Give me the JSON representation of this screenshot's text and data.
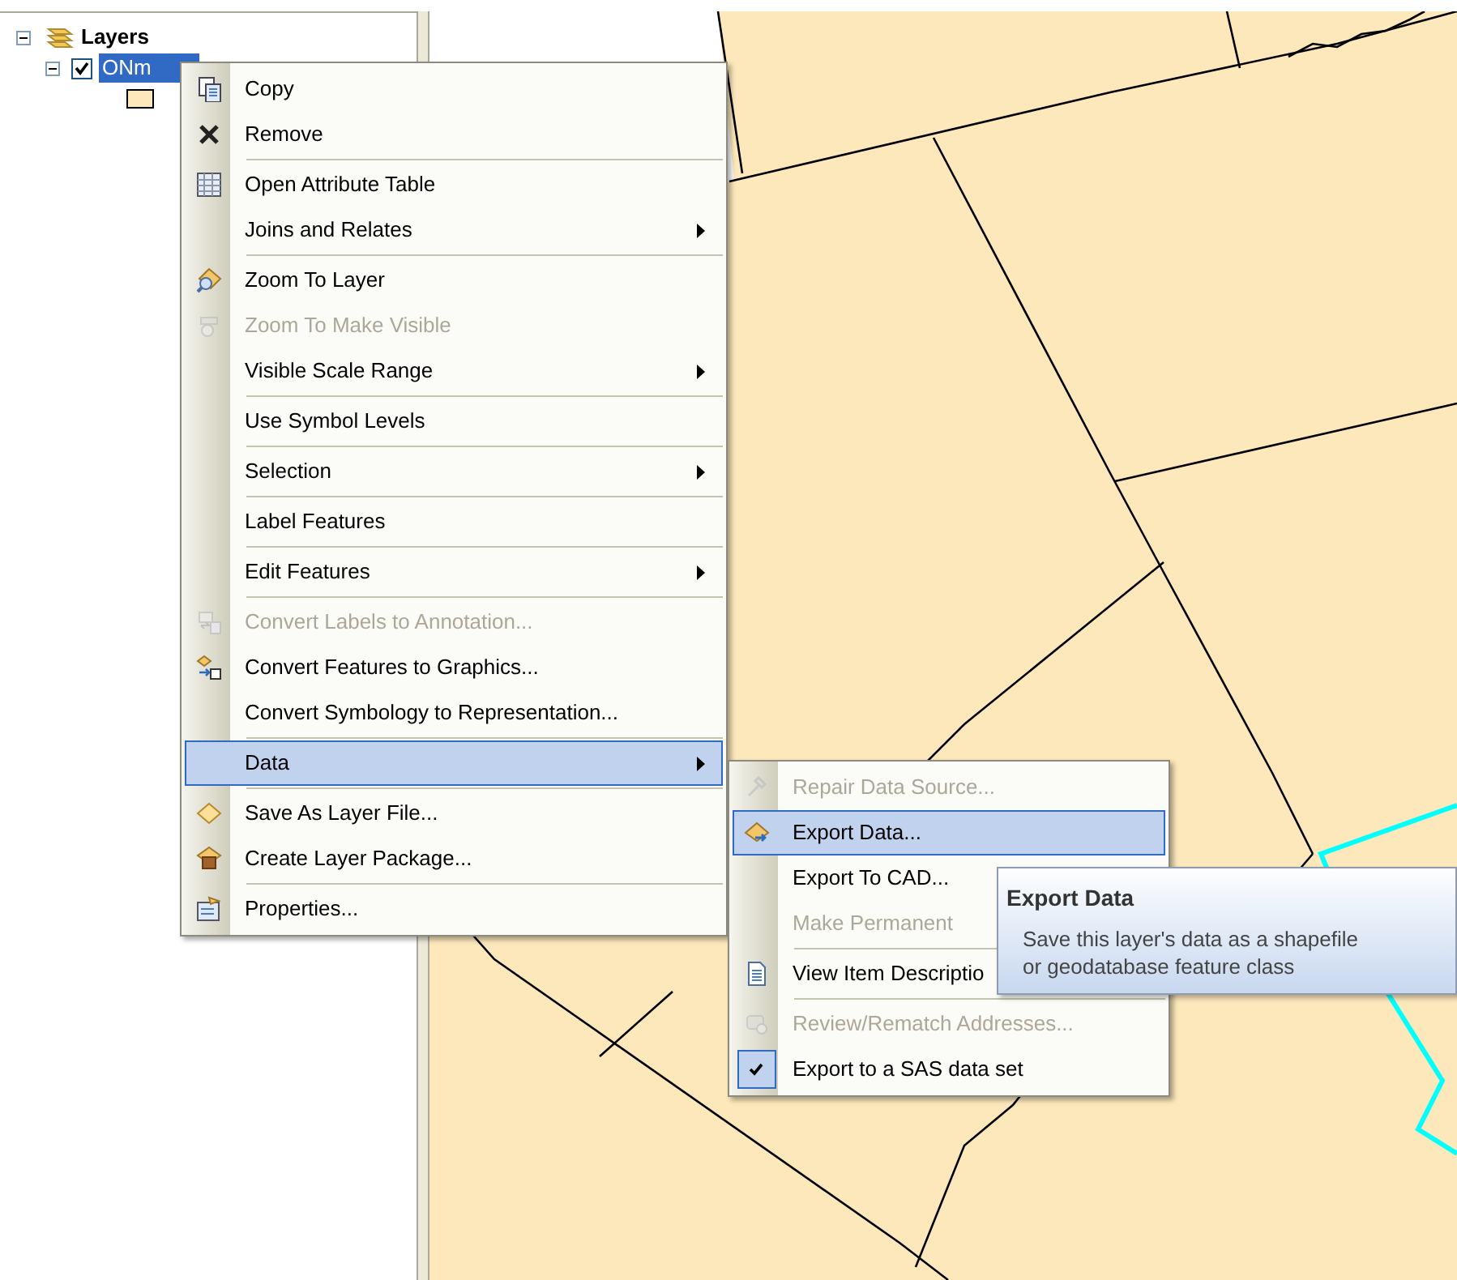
{
  "toc": {
    "label": "Layers",
    "expanded": true,
    "children": [
      {
        "label": "ONm",
        "checked": true,
        "selected": true,
        "expanded": true
      }
    ]
  },
  "context_menu": {
    "items": [
      {
        "kind": "item",
        "label": "Copy",
        "disabled": false,
        "submenu": false,
        "selected": false
      },
      {
        "kind": "item",
        "label": "Remove",
        "disabled": false,
        "submenu": false,
        "selected": false
      },
      {
        "kind": "separator"
      },
      {
        "kind": "item",
        "label": "Open Attribute Table",
        "disabled": false,
        "submenu": false,
        "selected": false
      },
      {
        "kind": "item",
        "label": "Joins and Relates",
        "disabled": false,
        "submenu": true,
        "selected": false
      },
      {
        "kind": "separator"
      },
      {
        "kind": "item",
        "label": "Zoom To Layer",
        "disabled": false,
        "submenu": false,
        "selected": false
      },
      {
        "kind": "item",
        "label": "Zoom To Make Visible",
        "disabled": true,
        "submenu": false,
        "selected": false
      },
      {
        "kind": "item",
        "label": "Visible Scale Range",
        "disabled": false,
        "submenu": true,
        "selected": false
      },
      {
        "kind": "separator"
      },
      {
        "kind": "item",
        "label": "Use Symbol Levels",
        "disabled": false,
        "submenu": false,
        "selected": false
      },
      {
        "kind": "separator"
      },
      {
        "kind": "item",
        "label": "Selection",
        "disabled": false,
        "submenu": true,
        "selected": false
      },
      {
        "kind": "separator"
      },
      {
        "kind": "item",
        "label": "Label Features",
        "disabled": false,
        "submenu": false,
        "selected": false
      },
      {
        "kind": "separator"
      },
      {
        "kind": "item",
        "label": "Edit Features",
        "disabled": false,
        "submenu": true,
        "selected": false
      },
      {
        "kind": "separator"
      },
      {
        "kind": "item",
        "label": "Convert Labels to Annotation...",
        "disabled": true,
        "submenu": false,
        "selected": false
      },
      {
        "kind": "item",
        "label": "Convert Features to Graphics...",
        "disabled": false,
        "submenu": false,
        "selected": false
      },
      {
        "kind": "item",
        "label": "Convert Symbology to Representation...",
        "disabled": false,
        "submenu": false,
        "selected": false
      },
      {
        "kind": "separator"
      },
      {
        "kind": "item",
        "label": "Data",
        "disabled": false,
        "submenu": true,
        "selected": true
      },
      {
        "kind": "separator"
      },
      {
        "kind": "item",
        "label": "Save As Layer File...",
        "disabled": false,
        "submenu": false,
        "selected": false
      },
      {
        "kind": "item",
        "label": "Create Layer Package...",
        "disabled": false,
        "submenu": false,
        "selected": false
      },
      {
        "kind": "separator"
      },
      {
        "kind": "item",
        "label": "Properties...",
        "disabled": false,
        "submenu": false,
        "selected": false
      }
    ]
  },
  "data_submenu": {
    "items": [
      {
        "kind": "item",
        "label": "Repair Data Source...",
        "disabled": true,
        "selected": false,
        "checked": false
      },
      {
        "kind": "item",
        "label": "Export Data...",
        "disabled": false,
        "selected": true,
        "checked": false
      },
      {
        "kind": "item",
        "label": "Export To CAD...",
        "disabled": false,
        "selected": false,
        "checked": false
      },
      {
        "kind": "item",
        "label": "Make Permanent",
        "disabled": true,
        "selected": false,
        "checked": false
      },
      {
        "kind": "separator"
      },
      {
        "kind": "item",
        "label": "View Item Descriptio",
        "disabled": false,
        "selected": false,
        "checked": false
      },
      {
        "kind": "separator"
      },
      {
        "kind": "item",
        "label": "Review/Rematch Addresses...",
        "disabled": true,
        "selected": false,
        "checked": false
      },
      {
        "kind": "item",
        "label": "Export to a SAS data set",
        "disabled": false,
        "selected": false,
        "checked": true
      }
    ]
  },
  "tooltip": {
    "title": "Export Data",
    "lines": [
      "Save this layer's data as a shapefile",
      "or geodatabase feature class"
    ]
  }
}
